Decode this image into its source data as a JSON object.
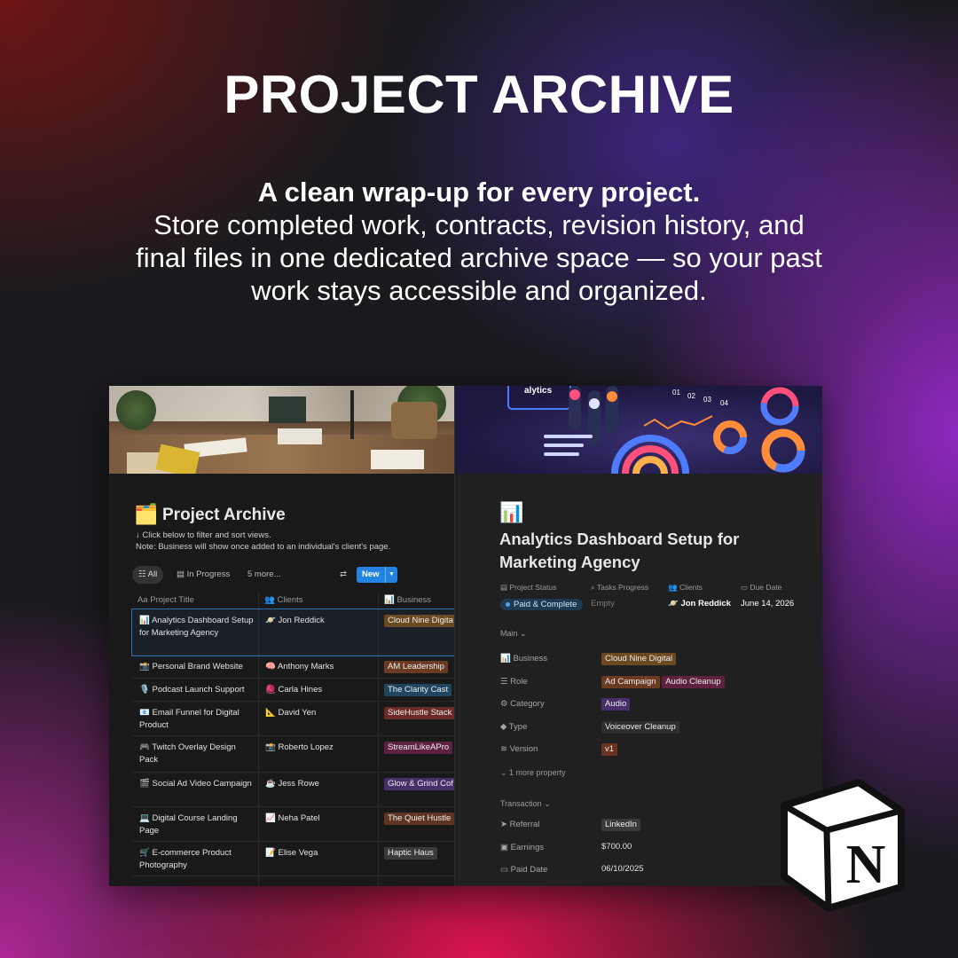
{
  "hero": {
    "title": "PROJECT ARCHIVE",
    "subtitle_bold": "A clean wrap-up for every project.",
    "subtitle_body": "Store completed work, contracts, revision history, and final files in one dedicated archive space — so your past work stays accessible and organized."
  },
  "database": {
    "icon": "file-cabinet-icon",
    "title": "Project Archive",
    "note_line1": "↓ Click below to filter and sort views.",
    "note_line2": "Note: Business will show once added to an individual's client's page.",
    "views": {
      "all": "All",
      "in_progress": "In Progress",
      "more": "5 more...",
      "new_button": "New"
    },
    "columns": {
      "title": "Project Title",
      "clients": "Clients",
      "business": "Business"
    },
    "rows": [
      {
        "icon": "📊",
        "title": "Analytics Dashboard Setup for Marketing Agency",
        "client_icon": "🪐",
        "client": "Jon Reddick",
        "business": "Cloud Nine Digita",
        "business_color": "#6b4a22"
      },
      {
        "icon": "📸",
        "title": "Personal Brand Website",
        "client_icon": "🧠",
        "client": "Anthony Marks",
        "business": "AM Leadership",
        "business_color": "#6b3a22"
      },
      {
        "icon": "🎙️",
        "title": "Podcast Launch Support",
        "client_icon": "🧶",
        "client": "Carla Hines",
        "business": "The Clarity Cast",
        "business_color": "#1f4561"
      },
      {
        "icon": "📧",
        "title": "Email Funnel for Digital Product",
        "client_icon": "📐",
        "client": "David Yen",
        "business": "SideHustle Stack",
        "business_color": "#6b2a2a"
      },
      {
        "icon": "🎮",
        "title": "Twitch Overlay Design Pack",
        "client_icon": "📸",
        "client": "Roberto Lopez",
        "business": "StreamLikeAPro",
        "business_color": "#5e2240"
      },
      {
        "icon": "🎬",
        "title": "Social Ad Video Campaign",
        "client_icon": "☕",
        "client": "Jess Rowe",
        "business": "Glow & Grind Cof",
        "business_color": "#47306a"
      },
      {
        "icon": "💻",
        "title": "Digital Course Landing Page",
        "client_icon": "📈",
        "client": "Neha Patel",
        "business": "The Quiet Hustle",
        "business_color": "#5e3522"
      },
      {
        "icon": "🛒",
        "title": "E-commerce Product Photography",
        "client_icon": "📝",
        "client": "Elise Vega",
        "business": "Haptic Haus",
        "business_color": "#3a3a3a"
      }
    ]
  },
  "detail": {
    "icon": "bar-chart-icon",
    "title": "Analytics Dashboard Setup for Marketing Agency",
    "headers": {
      "status": "Project Status",
      "tasks": "Tasks Progress",
      "clients": "Clients",
      "due": "Due Date"
    },
    "values": {
      "status": "Paid & Complete",
      "tasks": "Empty",
      "client": "Jon Reddick",
      "due": "June 14, 2026"
    },
    "main_section": "Main",
    "main": [
      {
        "name": "Business",
        "value": "Cloud Nine Digital",
        "color": "#6b4a22"
      },
      {
        "name": "Role",
        "value": "Ad Campaign",
        "value2": "Audio Cleanup",
        "color": "#6b3a22",
        "color2": "#5e2240"
      },
      {
        "name": "Category",
        "value": "Audio",
        "color": "#47306a"
      },
      {
        "name": "Type",
        "value": "Voiceover Cleanup",
        "color": "#2f2f2f"
      },
      {
        "name": "Version",
        "value": "v1",
        "color": "#6b3222"
      }
    ],
    "more_props": "1 more property",
    "transaction_section": "Transaction",
    "transaction": [
      {
        "name": "Referral",
        "value": "LinkedIn"
      },
      {
        "name": "Earnings",
        "value": "$700.00"
      },
      {
        "name": "Paid Date",
        "value": "06/10/2025"
      }
    ]
  },
  "brand": {
    "logo": "notion-logo",
    "letter": "N"
  }
}
